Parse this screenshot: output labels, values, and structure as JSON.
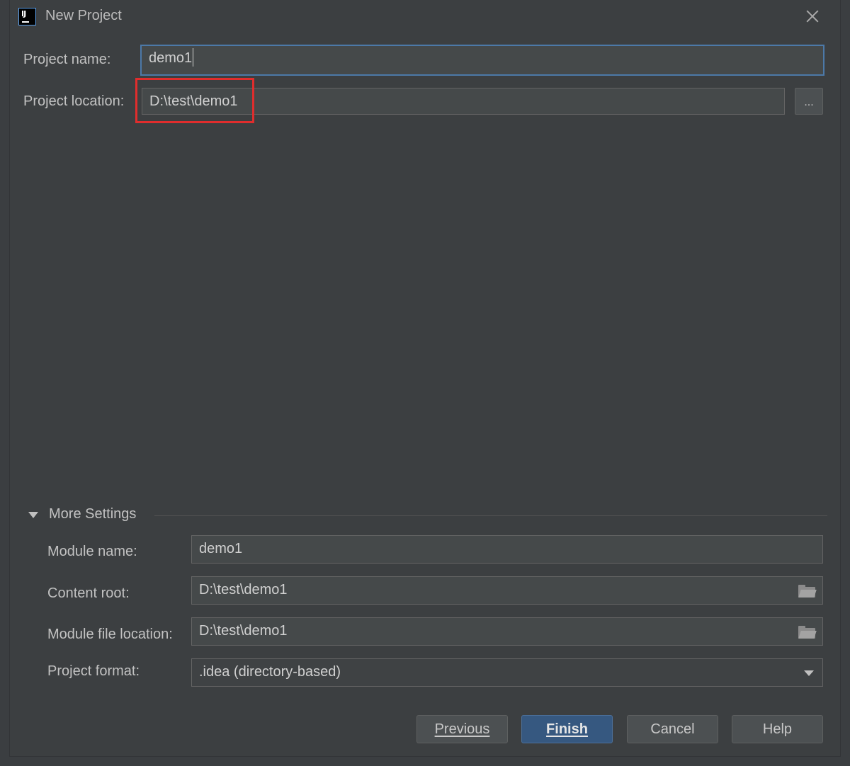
{
  "window": {
    "title": "New Project",
    "app_icon_text": "IJ"
  },
  "form": {
    "project_name_label": "Project name:",
    "project_name_value": "demo1",
    "project_location_label": "Project location:",
    "project_location_value": "D:\\test\\demo1",
    "browse_label": "..."
  },
  "more_settings": {
    "title": "More Settings",
    "module_name_label": "Module name:",
    "module_name_value": "demo1",
    "content_root_label": "Content root:",
    "content_root_value": "D:\\test\\demo1",
    "module_file_location_label": "Module file location:",
    "module_file_location_value": "D:\\test\\demo1",
    "project_format_label": "Project format:",
    "project_format_value": ".idea (directory-based)"
  },
  "buttons": {
    "previous": "Previous",
    "finish": "Finish",
    "cancel": "Cancel",
    "help": "Help"
  },
  "colors": {
    "background": "#3c3f41",
    "field": "#45494a",
    "primary_button": "#365880",
    "highlight": "#e02d2d",
    "focus_border": "#4c79a8"
  },
  "icons": [
    "intellij-app-icon",
    "close-icon",
    "expand-triangle-icon",
    "folder-icon",
    "dropdown-arrow-icon"
  ]
}
